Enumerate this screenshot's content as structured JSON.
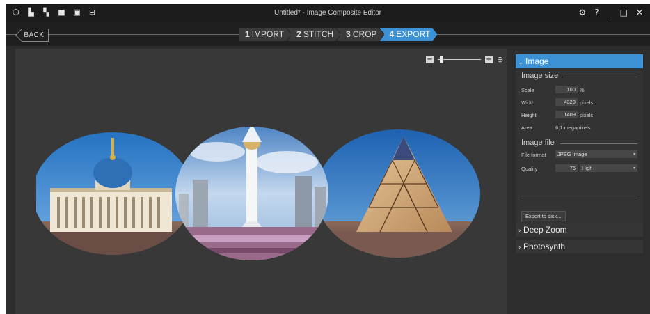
{
  "window": {
    "title": "Untitled* - Image Composite Editor",
    "toolbar_icons": [
      "app-icon",
      "new-panorama-icon",
      "new-stitch-icon",
      "open-icon",
      "save-icon",
      "save-as-icon"
    ],
    "controls": {
      "settings": "⚙",
      "help": "?",
      "minimize": "_",
      "maximize": "□",
      "close": "✕"
    }
  },
  "nav": {
    "back_label": "BACK",
    "steps": [
      {
        "num": "1",
        "label": "IMPORT",
        "active": false
      },
      {
        "num": "2",
        "label": "STITCH",
        "active": false
      },
      {
        "num": "3",
        "label": "CROP",
        "active": false
      },
      {
        "num": "4",
        "label": "EXPORT",
        "active": true
      }
    ]
  },
  "zoom": {
    "minus": "−",
    "plus": "+",
    "fit_icon": "fit-to-window-icon",
    "level": 0.05
  },
  "panel": {
    "image_section": {
      "header": "Image",
      "image_size_title": "Image size",
      "scale_label": "Scale",
      "scale_value": "100",
      "scale_unit": "%",
      "width_label": "Width",
      "width_value": "4329",
      "width_unit": "pixels",
      "height_label": "Height",
      "height_value": "1409",
      "height_unit": "pixels",
      "area_label": "Area",
      "area_value": "6,1 megapixels",
      "image_file_title": "Image file",
      "format_label": "File format",
      "format_value": "JPEG Image",
      "quality_label": "Quality",
      "quality_value": "75",
      "quality_level": "High",
      "export_button": "Export to disk..."
    },
    "deep_zoom_header": "Deep Zoom",
    "photosynth_header": "Photosynth"
  },
  "colors": {
    "accent": "#3d92d6",
    "background": "#2d2d2d",
    "canvas": "#383838"
  }
}
